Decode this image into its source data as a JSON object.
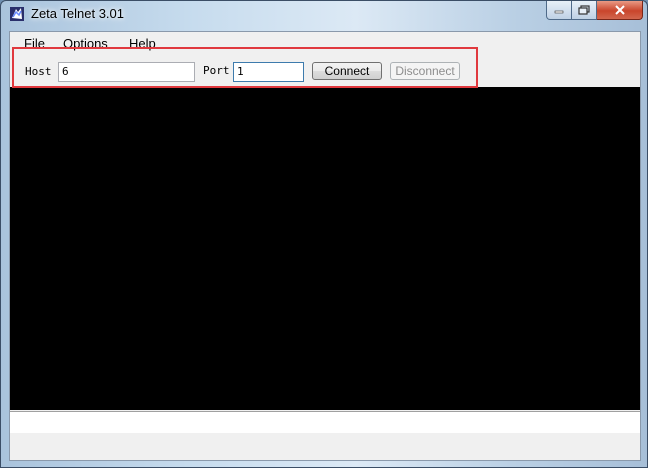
{
  "window": {
    "title": "Zeta Telnet 3.01"
  },
  "icons": {
    "app": "telnet-app-icon",
    "minimize": "minimize-icon",
    "maximize": "maximize-icon",
    "close": "close-icon"
  },
  "menu": {
    "items": [
      "File",
      "Options",
      "Help"
    ]
  },
  "toolbar": {
    "host_label": "Host",
    "host_value": "6",
    "port_label": "Port",
    "port_value": "1",
    "connect_label": "Connect",
    "disconnect_label": "Disconnect"
  },
  "colors": {
    "highlight": "#e0393e",
    "terminal_bg": "#000000"
  }
}
